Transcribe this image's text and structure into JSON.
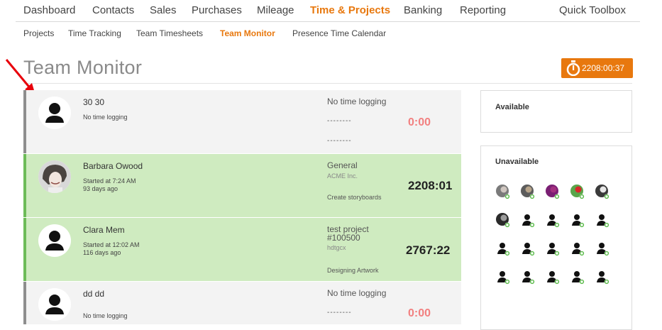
{
  "topnav": [
    {
      "label": "Dashboard",
      "active": false
    },
    {
      "label": "Contacts",
      "active": false
    },
    {
      "label": "Sales",
      "active": false
    },
    {
      "label": "Purchases",
      "active": false
    },
    {
      "label": "Mileage",
      "active": false
    },
    {
      "label": "Time & Projects",
      "active": true
    },
    {
      "label": "Banking",
      "active": false
    },
    {
      "label": "Reporting",
      "active": false
    },
    {
      "label": "Quick Toolbox",
      "active": false
    }
  ],
  "subnav": [
    {
      "label": "Projects",
      "active": false
    },
    {
      "label": "Time Tracking",
      "active": false
    },
    {
      "label": "Team Timesheets",
      "active": false
    },
    {
      "label": "Team Monitor",
      "active": true
    },
    {
      "label": "Presence Time Calendar",
      "active": false
    }
  ],
  "page": {
    "title": "Team Monitor",
    "timer": "2208:00:37"
  },
  "members": [
    {
      "name": "30 30",
      "status": "idle",
      "line1": "No time logging",
      "line2": "",
      "project": "No time logging",
      "client": "",
      "task": "",
      "time": "0:00",
      "avatar": "silhouette"
    },
    {
      "name": "Barbara Owood",
      "status": "active",
      "line1": "Started at 7:24 AM",
      "line2": "93 days ago",
      "project": "General",
      "client": "ACME Inc.",
      "task": "Create storyboards",
      "time": "2208:01",
      "avatar": "photo"
    },
    {
      "name": "Clara Mem",
      "status": "active",
      "line1": "Started at 12:02 AM",
      "line2": "116 days ago",
      "project": "test project #100500",
      "client": "hdtgcx",
      "task": "Designing Artwork",
      "time": "2767:22",
      "avatar": "silhouette"
    },
    {
      "name": "dd dd",
      "status": "idle",
      "line1": "No time logging",
      "line2": "",
      "project": "No time logging",
      "client": "",
      "task": "",
      "time": "0:00",
      "avatar": "silhouette"
    }
  ],
  "dashes": "--------",
  "sidebar": {
    "available_title": "Available",
    "unavailable_title": "Unavailable"
  },
  "unavailable_avatars": [
    "photo-grey",
    "photo-bike",
    "photo-purple",
    "photo-apple",
    "photo-person",
    "photo-stripe",
    "silhouette",
    "silhouette",
    "silhouette",
    "silhouette",
    "silhouette",
    "silhouette",
    "silhouette",
    "silhouette",
    "silhouette",
    "silhouette",
    "silhouette",
    "silhouette",
    "silhouette",
    "silhouette"
  ],
  "colors": {
    "accent": "#e8780e",
    "active_bg": "#cfebc0",
    "idle_bg": "#f3f3f3",
    "zero_time": "#f28080",
    "arrow": "#e8000b",
    "status_dot": "#58b947"
  }
}
